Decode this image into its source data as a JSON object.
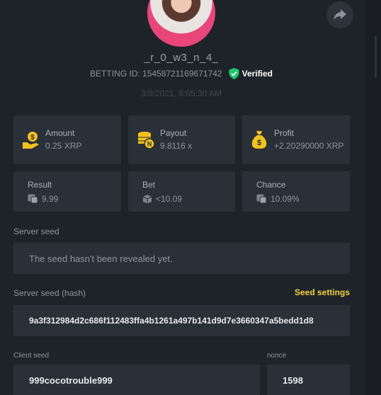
{
  "profile": {
    "username": "_r_0_w3_n_4_",
    "betting_id": "BETTING ID: 15458721169671742",
    "verified_label": "Verified",
    "datetime": "3/8/2021, 8:05:30 AM"
  },
  "stats_top": [
    {
      "label": "Amount",
      "value": "0.25 XRP",
      "icon": "coin-hand-icon"
    },
    {
      "label": "Payout",
      "value": "9.8116 x",
      "icon": "coin-stack-icon"
    },
    {
      "label": "Profit",
      "value": "+2.20290000 XRP",
      "icon": "money-bag-icon"
    }
  ],
  "stats_bottom": [
    {
      "label": "Result",
      "value": "9.99",
      "icon": "dice-icon"
    },
    {
      "label": "Bet",
      "value": "<10.09",
      "icon": "cube-icon"
    },
    {
      "label": "Chance",
      "value": "10.09%",
      "icon": "dice-icon"
    }
  ],
  "server_seed": {
    "label": "Server seed",
    "value": "The seed hasn't been revealed yet."
  },
  "server_seed_hash": {
    "label": "Server seed (hash)",
    "settings_link": "Seed settings",
    "value": "9a3f312984d2c686f112483ffa4b1261a497b141d9d7e3660347a5bedd1d8"
  },
  "client_seed": {
    "label": "Client seed",
    "value": "999cocotrouble999"
  },
  "nonce": {
    "label": "nonce",
    "value": "1598"
  },
  "colors": {
    "background": "#1e2329",
    "card": "#2a3038",
    "accent_yellow": "#f3d13a",
    "verified_green": "#1fc46a"
  }
}
